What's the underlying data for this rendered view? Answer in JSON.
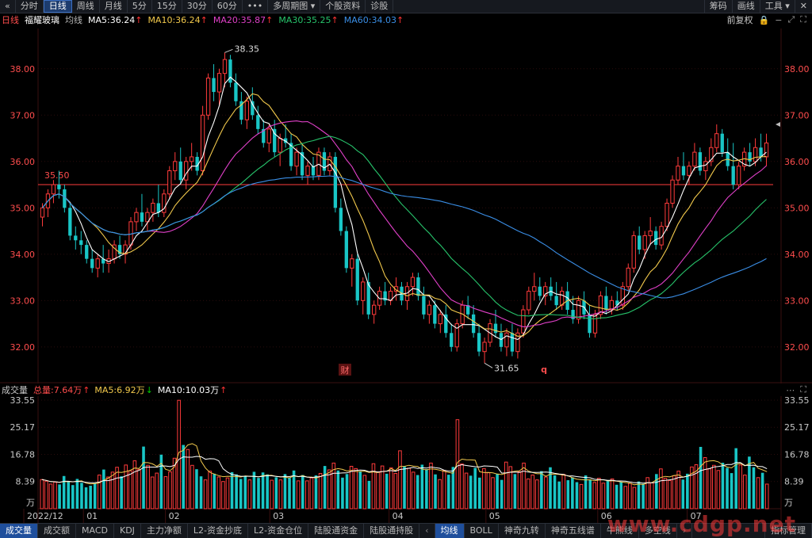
{
  "topbar": {
    "back_glyph": "«",
    "tabs": [
      {
        "label": "分时",
        "active": false
      },
      {
        "label": "日线",
        "active": true
      },
      {
        "label": "周线",
        "active": false
      },
      {
        "label": "月线",
        "active": false
      },
      {
        "label": "5分",
        "active": false
      },
      {
        "label": "15分",
        "active": false
      },
      {
        "label": "30分",
        "active": false
      },
      {
        "label": "60分",
        "active": false
      },
      {
        "label": "•••",
        "active": false
      },
      {
        "label": "多周期图 ▾",
        "active": false
      },
      {
        "label": "个股资料",
        "active": false
      },
      {
        "label": "诊股",
        "active": false
      }
    ],
    "right": [
      "筹码",
      "画线",
      "工具 ▾"
    ],
    "close_glyph": "✕"
  },
  "info": {
    "period": "日线",
    "stock_name": "福耀玻璃",
    "ma_label": "均线",
    "ma": [
      {
        "label": "MA5:36.24",
        "color": "#ffffff",
        "arrow": "↑"
      },
      {
        "label": "MA10:36.24",
        "color": "#f2c94c",
        "arrow": "↑"
      },
      {
        "label": "MA20:35.87",
        "color": "#e040c8",
        "arrow": "↑"
      },
      {
        "label": "MA30:35.25",
        "color": "#27c46b",
        "arrow": "↑"
      },
      {
        "label": "MA60:34.03",
        "color": "#3a8ee6",
        "arrow": "↑"
      }
    ],
    "adjust": "前复权"
  },
  "volume_info": {
    "title": "成交量",
    "total": "总量:7.64万",
    "ma5": "MA5:6.92万",
    "ma10": "MA10:10.03万",
    "total_color": "#ff4d4d",
    "ma5_color": "#f2c94c",
    "ma10_color": "#ffffff"
  },
  "bottombar": {
    "left": [
      "成交量",
      "成交额",
      "MACD",
      "KDJ",
      "主力净额",
      "L2-资金抄底",
      "L2-资金仓位",
      "陆股通资金",
      "陆股通持股"
    ],
    "right": [
      "均线",
      "BOLL",
      "神奇九转",
      "神奇五线谱",
      "牛熊线",
      "多空线"
    ],
    "more": "指标管理",
    "watermark": "www.cdgp.net"
  },
  "markers": {
    "cai": "财",
    "q": "q"
  },
  "chart_data": [
    {
      "type": "candlestick",
      "title": "",
      "y_ticks": [
        "38.00",
        "37.00",
        "36.00",
        "35.00",
        "34.00",
        "33.00",
        "32.00"
      ],
      "ylim": [
        31.45,
        38.8
      ],
      "x_ticks": [
        "2022/12",
        "01",
        "02",
        "03",
        "04",
        "05",
        "06",
        "07"
      ],
      "annotations": {
        "high": "38.35",
        "low": "31.65",
        "ref_line": "35.50",
        "ref_value": 35.5
      },
      "ohlc": [
        [
          34.8,
          35.1,
          34.6,
          35.0
        ],
        [
          35.0,
          35.4,
          34.8,
          35.3
        ],
        [
          35.3,
          35.6,
          35.1,
          35.5
        ],
        [
          35.5,
          35.8,
          35.2,
          35.4
        ],
        [
          35.4,
          35.5,
          34.9,
          35.0
        ],
        [
          35.0,
          35.1,
          34.3,
          34.4
        ],
        [
          34.4,
          34.6,
          34.1,
          34.3
        ],
        [
          34.3,
          34.5,
          34.0,
          34.2
        ],
        [
          34.2,
          34.3,
          33.8,
          33.9
        ],
        [
          33.9,
          34.1,
          33.6,
          33.7
        ],
        [
          33.7,
          34.0,
          33.5,
          33.9
        ],
        [
          33.9,
          34.2,
          33.6,
          33.8
        ],
        [
          33.8,
          34.1,
          33.6,
          33.9
        ],
        [
          33.9,
          34.3,
          33.8,
          34.2
        ],
        [
          34.2,
          34.4,
          33.9,
          34.0
        ],
        [
          34.0,
          34.3,
          33.8,
          34.2
        ],
        [
          34.2,
          34.8,
          34.1,
          34.7
        ],
        [
          34.7,
          35.0,
          34.5,
          34.9
        ],
        [
          34.9,
          35.3,
          34.6,
          34.7
        ],
        [
          34.7,
          35.0,
          34.5,
          34.9
        ],
        [
          34.9,
          35.2,
          34.7,
          35.1
        ],
        [
          35.1,
          35.5,
          34.8,
          34.9
        ],
        [
          34.9,
          35.4,
          34.8,
          35.3
        ],
        [
          35.3,
          35.9,
          35.2,
          35.8
        ],
        [
          35.8,
          36.2,
          35.6,
          36.0
        ],
        [
          36.0,
          36.3,
          35.5,
          35.6
        ],
        [
          35.6,
          36.1,
          35.4,
          36.0
        ],
        [
          36.0,
          36.4,
          35.8,
          36.1
        ],
        [
          36.1,
          36.2,
          35.7,
          35.8
        ],
        [
          35.8,
          37.2,
          35.7,
          37.0
        ],
        [
          37.0,
          37.9,
          36.9,
          37.8
        ],
        [
          37.8,
          38.1,
          37.3,
          37.5
        ],
        [
          37.5,
          38.0,
          37.2,
          37.9
        ],
        [
          37.9,
          38.35,
          37.6,
          38.2
        ],
        [
          38.2,
          38.3,
          37.6,
          37.7
        ],
        [
          37.7,
          37.9,
          37.2,
          37.3
        ],
        [
          37.3,
          37.5,
          36.8,
          36.9
        ],
        [
          36.9,
          37.4,
          36.7,
          37.3
        ],
        [
          37.3,
          37.6,
          36.9,
          37.0
        ],
        [
          37.0,
          37.2,
          36.6,
          36.7
        ],
        [
          36.7,
          36.9,
          36.3,
          36.4
        ],
        [
          36.4,
          36.8,
          36.2,
          36.7
        ],
        [
          36.7,
          36.9,
          36.1,
          36.2
        ],
        [
          36.2,
          36.6,
          35.9,
          36.5
        ],
        [
          36.5,
          36.8,
          36.3,
          36.4
        ],
        [
          36.4,
          36.6,
          35.8,
          35.9
        ],
        [
          35.9,
          36.3,
          35.7,
          36.2
        ],
        [
          36.2,
          36.4,
          35.6,
          35.7
        ],
        [
          35.7,
          36.0,
          35.5,
          35.9
        ],
        [
          35.9,
          36.1,
          35.6,
          35.7
        ],
        [
          35.7,
          36.3,
          35.6,
          36.2
        ],
        [
          36.2,
          36.3,
          35.7,
          35.8
        ],
        [
          35.8,
          36.2,
          35.7,
          36.1
        ],
        [
          36.1,
          36.2,
          34.9,
          35.0
        ],
        [
          35.0,
          35.2,
          34.4,
          34.5
        ],
        [
          34.5,
          34.6,
          33.6,
          33.7
        ],
        [
          33.7,
          34.0,
          33.3,
          33.9
        ],
        [
          33.9,
          34.0,
          32.9,
          33.0
        ],
        [
          33.0,
          33.5,
          32.7,
          33.4
        ],
        [
          33.4,
          33.6,
          32.6,
          32.7
        ],
        [
          32.7,
          33.0,
          32.5,
          32.9
        ],
        [
          32.9,
          33.3,
          32.8,
          33.2
        ],
        [
          33.2,
          33.4,
          32.9,
          33.0
        ],
        [
          33.0,
          33.3,
          32.9,
          33.2
        ],
        [
          33.2,
          33.5,
          33.0,
          33.3
        ],
        [
          33.3,
          33.4,
          32.9,
          33.0
        ],
        [
          33.0,
          33.4,
          32.8,
          33.3
        ],
        [
          33.3,
          33.6,
          33.1,
          33.5
        ],
        [
          33.5,
          33.6,
          33.0,
          33.1
        ],
        [
          33.1,
          33.3,
          32.6,
          32.7
        ],
        [
          32.7,
          33.0,
          32.5,
          32.9
        ],
        [
          32.9,
          33.0,
          32.4,
          32.5
        ],
        [
          32.5,
          32.8,
          32.3,
          32.7
        ],
        [
          32.7,
          32.9,
          32.2,
          32.3
        ],
        [
          32.3,
          32.5,
          31.9,
          32.0
        ],
        [
          32.0,
          32.6,
          31.9,
          32.5
        ],
        [
          32.5,
          33.0,
          32.4,
          32.9
        ],
        [
          32.9,
          33.1,
          32.6,
          32.7
        ],
        [
          32.7,
          32.9,
          32.2,
          32.3
        ],
        [
          32.3,
          32.5,
          31.8,
          31.9
        ],
        [
          31.9,
          32.2,
          31.65,
          32.1
        ],
        [
          32.1,
          32.6,
          32.0,
          32.5
        ],
        [
          32.5,
          32.8,
          32.2,
          32.3
        ],
        [
          32.3,
          32.5,
          31.9,
          32.0
        ],
        [
          32.0,
          32.4,
          31.8,
          32.3
        ],
        [
          32.3,
          32.5,
          31.8,
          31.9
        ],
        [
          31.9,
          32.4,
          31.75,
          32.3
        ],
        [
          32.3,
          32.9,
          32.2,
          32.8
        ],
        [
          32.8,
          33.3,
          32.7,
          33.2
        ],
        [
          33.2,
          33.6,
          33.0,
          33.3
        ],
        [
          33.3,
          33.5,
          33.0,
          33.1
        ],
        [
          33.1,
          33.4,
          32.9,
          33.3
        ],
        [
          33.3,
          33.5,
          33.0,
          33.1
        ],
        [
          33.1,
          33.4,
          32.8,
          32.9
        ],
        [
          32.9,
          33.3,
          32.8,
          33.2
        ],
        [
          33.2,
          33.4,
          32.7,
          32.8
        ],
        [
          32.8,
          33.1,
          32.5,
          32.6
        ],
        [
          32.6,
          33.1,
          32.5,
          33.0
        ],
        [
          33.0,
          33.2,
          32.6,
          32.7
        ],
        [
          32.7,
          32.9,
          32.2,
          32.3
        ],
        [
          32.3,
          32.8,
          32.2,
          32.7
        ],
        [
          32.7,
          33.2,
          32.6,
          33.1
        ],
        [
          33.1,
          33.3,
          32.7,
          32.8
        ],
        [
          32.8,
          33.1,
          32.7,
          33.0
        ],
        [
          33.0,
          33.2,
          32.8,
          32.9
        ],
        [
          32.9,
          33.4,
          32.8,
          33.3
        ],
        [
          33.3,
          33.8,
          33.2,
          33.7
        ],
        [
          33.7,
          34.5,
          33.6,
          34.4
        ],
        [
          34.4,
          34.6,
          34.0,
          34.1
        ],
        [
          34.1,
          34.5,
          33.9,
          34.4
        ],
        [
          34.4,
          34.8,
          34.2,
          34.5
        ],
        [
          34.5,
          34.6,
          34.1,
          34.2
        ],
        [
          34.2,
          34.7,
          34.1,
          34.6
        ],
        [
          34.6,
          35.2,
          34.5,
          35.1
        ],
        [
          35.1,
          35.7,
          35.0,
          35.6
        ],
        [
          35.6,
          36.1,
          35.5,
          35.9
        ],
        [
          35.9,
          36.2,
          35.6,
          35.7
        ],
        [
          35.7,
          36.0,
          35.5,
          35.9
        ],
        [
          35.9,
          36.4,
          35.8,
          36.2
        ],
        [
          36.2,
          36.3,
          35.7,
          35.8
        ],
        [
          35.8,
          36.1,
          35.6,
          36.0
        ],
        [
          36.0,
          36.5,
          35.9,
          36.3
        ],
        [
          36.3,
          36.8,
          36.2,
          36.6
        ],
        [
          36.6,
          36.7,
          36.1,
          36.2
        ],
        [
          36.2,
          36.5,
          35.8,
          35.9
        ],
        [
          35.9,
          36.4,
          35.4,
          35.5
        ],
        [
          35.5,
          36.0,
          35.4,
          35.9
        ],
        [
          35.9,
          36.3,
          35.8,
          36.2
        ],
        [
          36.2,
          36.4,
          35.9,
          36.0
        ],
        [
          36.0,
          36.5,
          35.9,
          36.3
        ],
        [
          36.3,
          36.6,
          36.0,
          36.1
        ],
        [
          36.1,
          36.6,
          35.9,
          36.4
        ]
      ]
    },
    {
      "type": "bar",
      "title": "",
      "unit": "万",
      "y_ticks": [
        "33.55",
        "25.17",
        "16.78",
        "8.39"
      ],
      "ylim": [
        0,
        33.55
      ],
      "values": [
        9,
        8.5,
        7.6,
        8.2,
        7.5,
        10.1,
        8.4,
        7.3,
        9.2,
        8.0,
        6.6,
        7.1,
        7.8,
        10.4,
        12.1,
        9.8,
        11.3,
        12.8,
        10.0,
        13.5,
        11.7,
        14.8,
        12.1,
        19.2,
        13.4,
        9.8,
        11.0,
        16.7,
        9.9,
        11.4,
        15.6,
        33.5,
        19.7,
        18.3,
        13.4,
        12.2,
        10.0,
        8.9,
        11.6,
        10.8,
        9.8,
        8.4,
        9.5,
        11.3,
        10.6,
        9.2,
        10.1,
        8.9,
        11.4,
        9.5,
        11.2,
        10.6,
        8.8,
        9.7,
        8.9,
        10.7,
        9.5,
        11.8,
        8.6,
        10.4,
        8.6,
        9.5,
        10.3,
        10.9,
        13.2,
        12.0,
        14.1,
        11.8,
        9.6,
        10.7,
        13.1,
        12.4,
        11.6,
        10.3,
        8.6,
        13.9,
        11.4,
        13.2,
        10.8,
        12.6,
        10.9,
        17.9,
        13.2,
        12.5,
        11.3,
        10.4,
        13.6,
        12.2,
        14.1,
        10.6,
        9.0,
        11.8,
        10.5,
        12.9,
        27.5,
        13.8,
        11.0,
        10.2,
        12.6,
        9.6,
        12.4,
        11.1,
        9.6,
        10.8,
        8.9,
        14.4,
        13.0,
        10.7,
        11.4,
        14.1,
        9.2,
        10.4,
        8.9,
        11.6,
        9.8,
        12.8,
        10.3,
        8.4,
        10.6,
        8.8,
        9.7,
        8.2,
        7.5,
        10.3,
        9.0,
        8.1,
        9.4,
        7.9,
        8.6,
        9.2,
        7.4,
        8.3,
        6.9,
        7.8,
        6.6,
        8.4,
        7.7,
        9.6,
        8.0,
        10.7,
        12.3,
        9.4,
        8.7,
        10.2,
        11.6,
        9.0,
        10.8,
        12.9,
        13.6,
        19.1,
        15.8,
        12.3,
        13.4,
        11.8,
        14.2,
        12.6,
        11.0,
        18.7,
        13.5,
        10.4,
        16.1,
        12.8,
        9.6,
        11.1,
        7.6
      ]
    }
  ]
}
